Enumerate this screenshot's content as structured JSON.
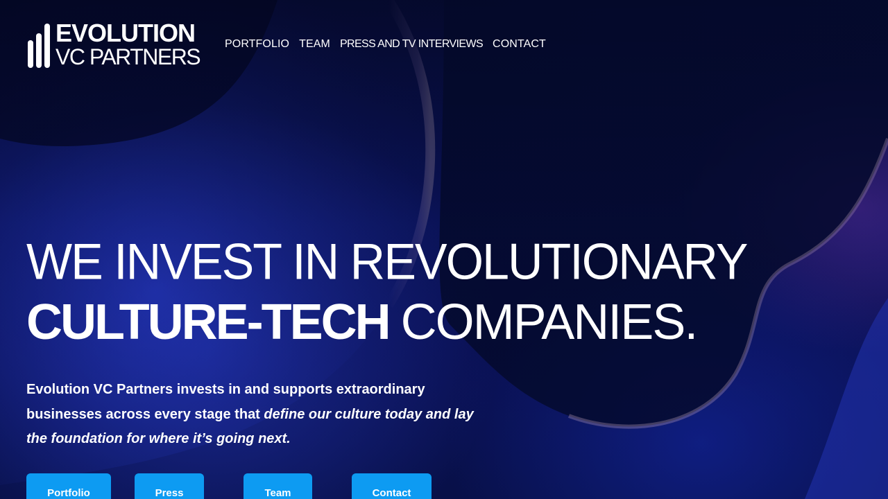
{
  "header": {
    "logo": {
      "line1": "EVOLUTION",
      "line2": "VC PARTNERS"
    },
    "nav": [
      {
        "label": "PORTFOLIO"
      },
      {
        "label": "TEAM"
      },
      {
        "label": "PRESS AND TV INTERVIEWS"
      },
      {
        "label": "CONTACT"
      }
    ]
  },
  "hero": {
    "headline": {
      "line1": "WE INVEST IN REVOLUTIONARY",
      "line2_strong": "CULTURE-TECH",
      "line2_rest": "COMPANIES."
    },
    "subtext": {
      "plain": "Evolution VC Partners invests in and supports extraordinary businesses across every stage that",
      "emphasis": "define our culture today and lay the foundation for where it’s going next."
    },
    "buttons": [
      {
        "label": "Portfolio"
      },
      {
        "label": "Press"
      },
      {
        "label": "Team"
      },
      {
        "label": "Contact"
      }
    ]
  },
  "colors": {
    "background": "#060b33",
    "button": "#0d9bf2",
    "text": "#ffffff"
  }
}
